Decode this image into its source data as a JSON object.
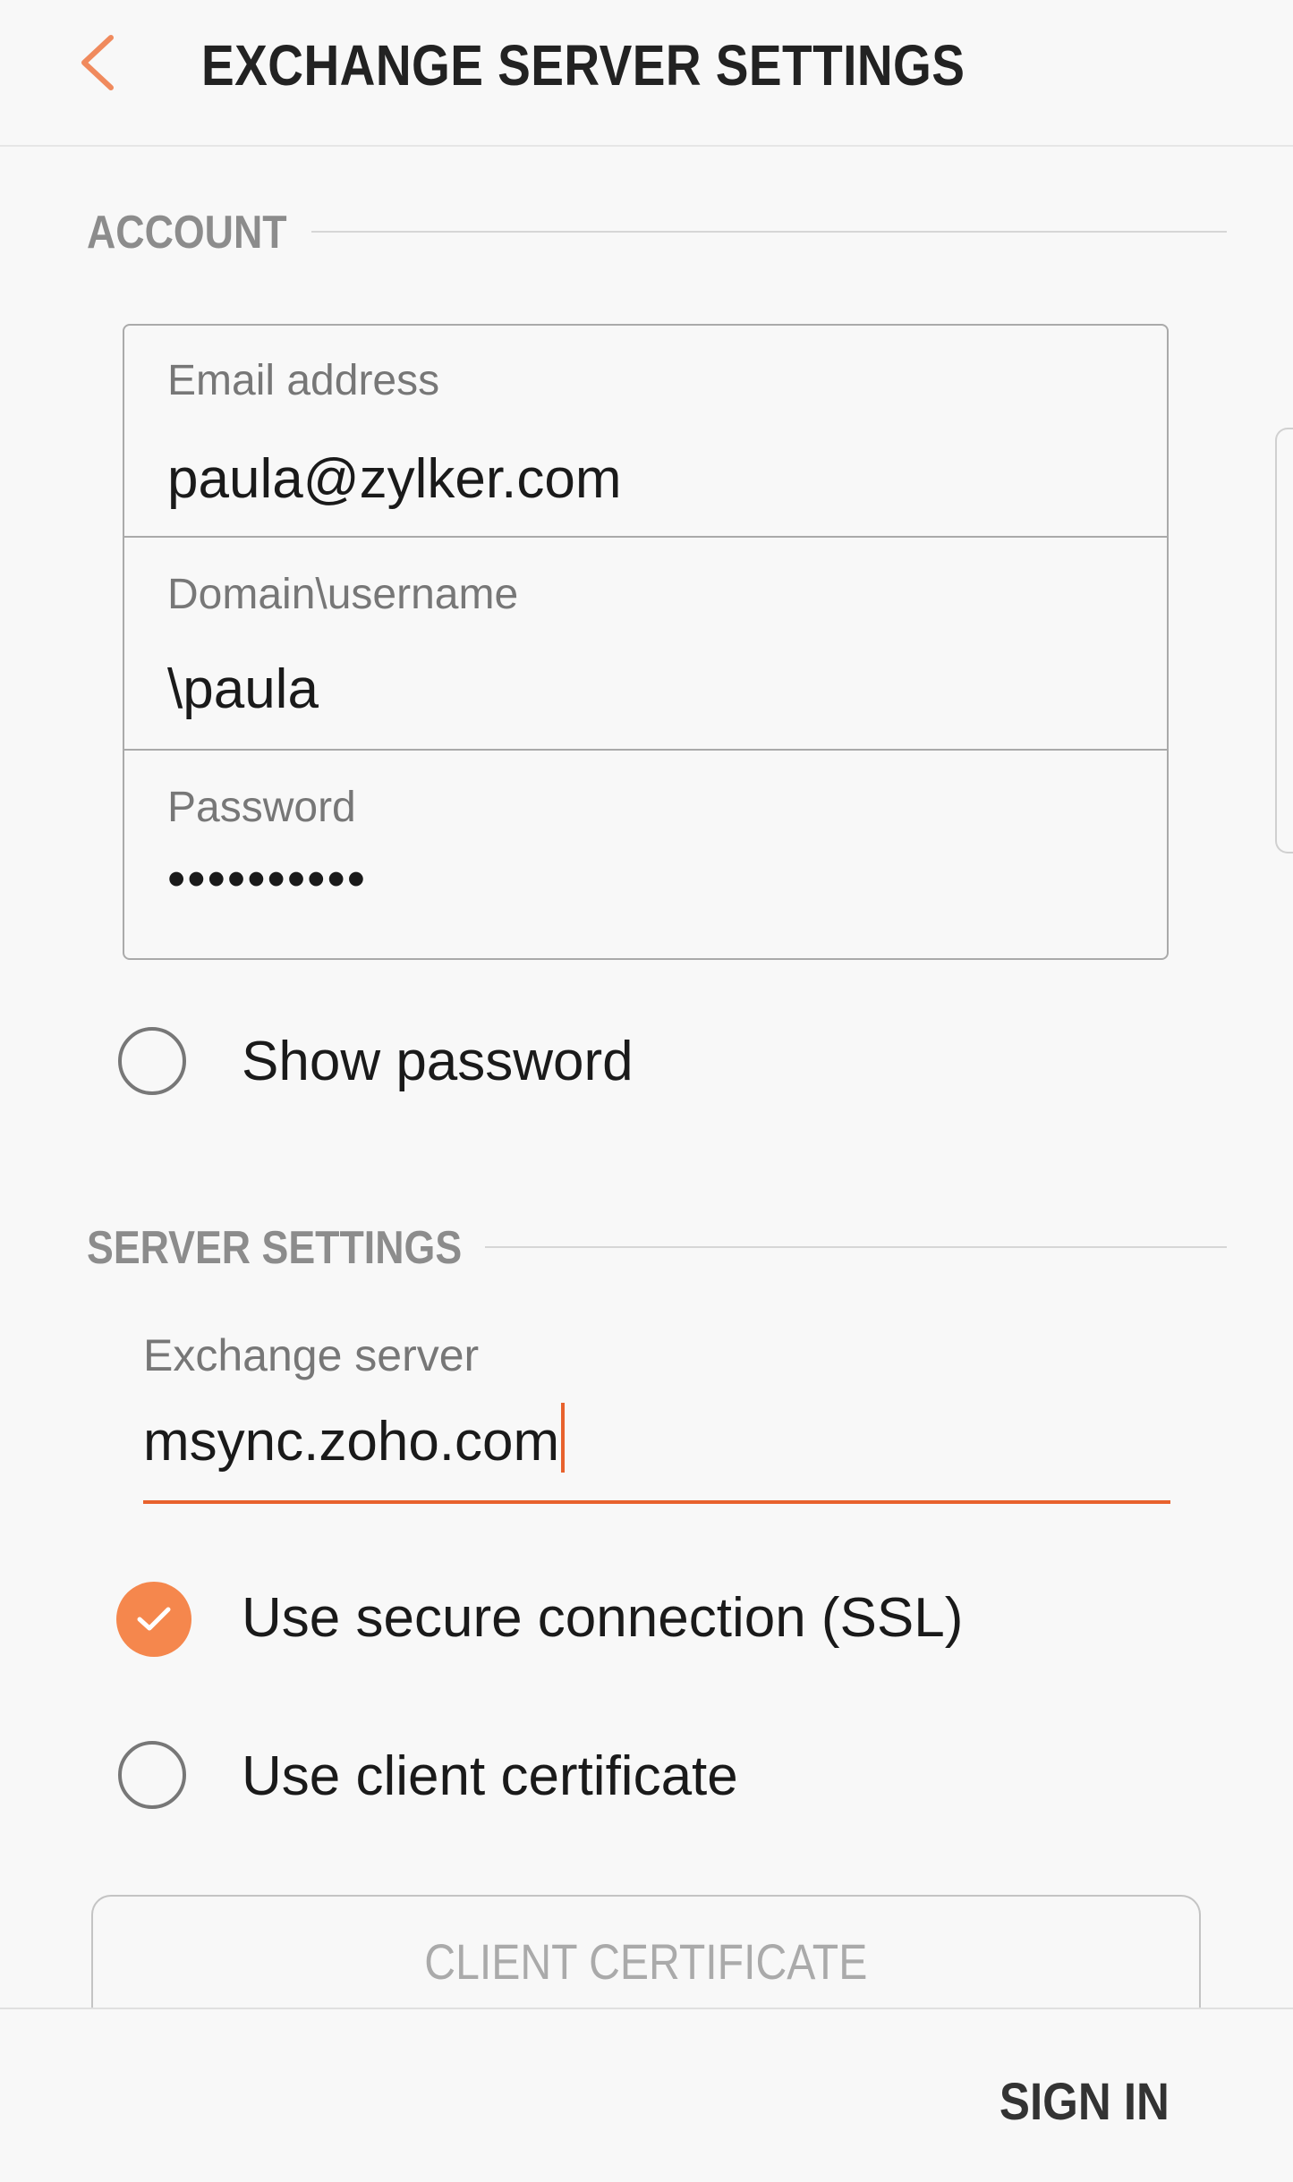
{
  "header": {
    "title": "EXCHANGE SERVER SETTINGS",
    "back_icon": "chevron-left-icon"
  },
  "colors": {
    "accent": "#f5874d",
    "caret": "#e8622d",
    "section_text": "#8c8c8c",
    "background": "#f8f8f8"
  },
  "account": {
    "section_title": "ACCOUNT",
    "email_label": "Email address",
    "email_value": "paula@zylker.com",
    "username_label": "Domain\\username",
    "username_value": "\\paula",
    "password_label": "Password",
    "password_value": "••••••••••",
    "show_password_label": "Show password",
    "show_password_checked": false
  },
  "server": {
    "section_title": "SERVER SETTINGS",
    "exchange_label": "Exchange server",
    "exchange_value": "msync.zoho.com",
    "ssl_label": "Use secure connection (SSL)",
    "ssl_checked": true,
    "cert_option_label": "Use client certificate",
    "cert_option_checked": false,
    "cert_button_label": "CLIENT CERTIFICATE"
  },
  "footer": {
    "signin_label": "SIGN IN"
  }
}
